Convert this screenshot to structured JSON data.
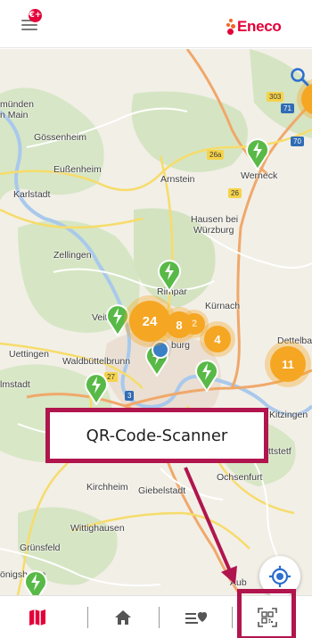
{
  "header": {
    "notification_badge": "€+",
    "brand_name": "Eneco"
  },
  "map": {
    "places": [
      {
        "id": "place-munden",
        "label": "münden"
      },
      {
        "id": "place-main",
        "label": "n Main"
      },
      {
        "id": "place-gossenheim",
        "label": "Gössenheim"
      },
      {
        "id": "place-eussenheim",
        "label": "Eußenheim"
      },
      {
        "id": "place-karlstadt",
        "label": "Karlstadt"
      },
      {
        "id": "place-arnstein",
        "label": "Arnstein"
      },
      {
        "id": "place-werneck",
        "label": "Werneck"
      },
      {
        "id": "place-hausen",
        "label": "Hausen bei"
      },
      {
        "id": "place-hausen2",
        "label": "Würzburg"
      },
      {
        "id": "place-zellingen",
        "label": "Zellingen"
      },
      {
        "id": "place-rimpar",
        "label": "Rimpar"
      },
      {
        "id": "place-kurnach",
        "label": "Kürnach"
      },
      {
        "id": "place-veitshoch",
        "label": "Veitshö"
      },
      {
        "id": "place-uettingen",
        "label": "Uettingen"
      },
      {
        "id": "place-waldbuttel",
        "label": "Waldbüttelbrunn"
      },
      {
        "id": "place-dettelba",
        "label": "Dettelba"
      },
      {
        "id": "place-burg",
        "label": "burg"
      },
      {
        "id": "place-helmstadt",
        "label": "lmstadt"
      },
      {
        "id": "place-kitzingen",
        "label": "Kitzingen"
      },
      {
        "id": "place-rottstetf",
        "label": "ttstetf"
      },
      {
        "id": "place-kirchheim",
        "label": "Kirchheim"
      },
      {
        "id": "place-giebelstadt",
        "label": "Giebelstadt"
      },
      {
        "id": "place-ochsenfurt",
        "label": "Ochsenfurt"
      },
      {
        "id": "place-grunsfeld",
        "label": "Grünsfeld"
      },
      {
        "id": "place-wittighausen",
        "label": "Wittighausen"
      },
      {
        "id": "place-konigshofen",
        "label": "önigshofen"
      },
      {
        "id": "place-aub",
        "label": "Aub"
      }
    ],
    "road_shields": [
      {
        "id": "shield-303",
        "label": "303",
        "color": "yellow"
      },
      {
        "id": "shield-71",
        "label": "71",
        "color": "blue"
      },
      {
        "id": "shield-70",
        "label": "70",
        "color": "blue"
      },
      {
        "id": "shield-26a",
        "label": "26a",
        "color": "yellow"
      },
      {
        "id": "shield-26",
        "label": "26",
        "color": "yellow"
      },
      {
        "id": "shield-27",
        "label": "27",
        "color": "yellow"
      },
      {
        "id": "shield-3",
        "label": "3",
        "color": "blue"
      }
    ],
    "clusters": [
      {
        "id": "cluster-24",
        "label": "24"
      },
      {
        "id": "cluster-8",
        "label": "8"
      },
      {
        "id": "cluster-2",
        "label": "2"
      },
      {
        "id": "cluster-4",
        "label": "4"
      },
      {
        "id": "cluster-11",
        "label": "11"
      }
    ]
  },
  "callout": {
    "label": "QR-Code-Scanner"
  },
  "nav": {
    "items": [
      "map",
      "home",
      "favorites",
      "qr-scanner"
    ]
  },
  "colors": {
    "brand_red": "#e4003a",
    "brand_orange": "#f26522",
    "cluster_orange": "#f5a623",
    "charger_green": "#58b947",
    "highlight": "#b0154e",
    "user_blue": "#3b7fc4"
  }
}
